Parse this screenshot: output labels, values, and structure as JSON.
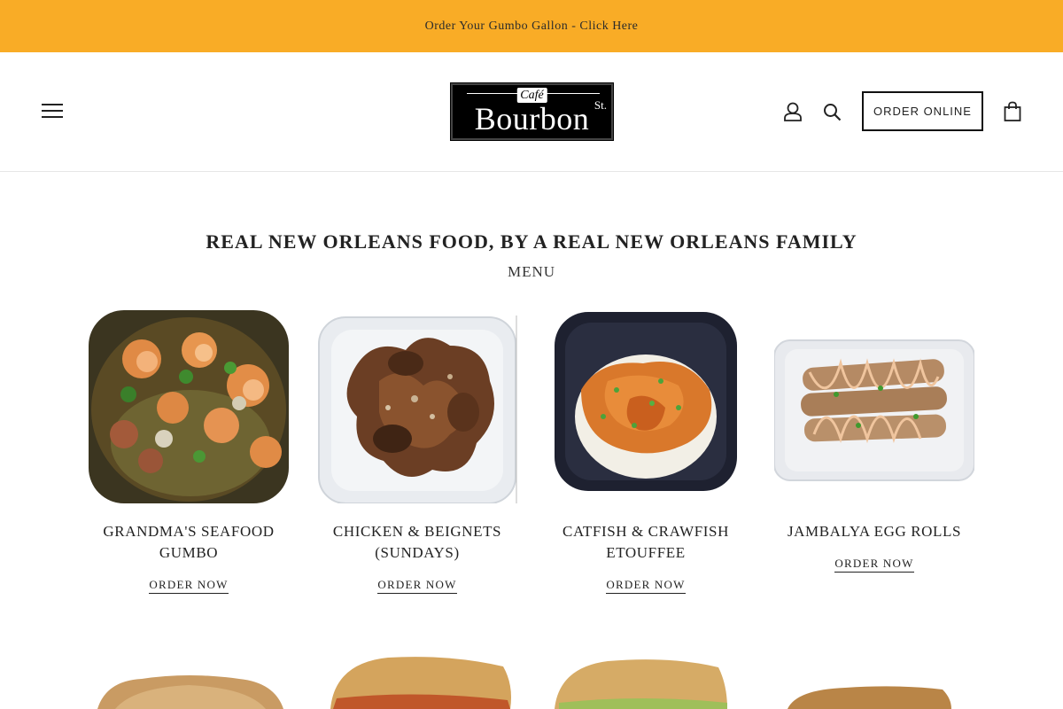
{
  "announcement": {
    "text": "Order Your Gumbo Gallon - Click Here"
  },
  "header": {
    "logo": {
      "cafe": "Café",
      "name": "Bourbon",
      "st": "St."
    },
    "order_button": "ORDER ONLINE",
    "icons": [
      "menu-icon",
      "user-icon",
      "search-icon",
      "cart-icon"
    ]
  },
  "main": {
    "heading": "REAL NEW ORLEANS FOOD, BY A REAL NEW ORLEANS FAMILY",
    "subheading": "MENU",
    "items": [
      {
        "name": "GRANDMA'S SEAFOOD GUMBO",
        "cta": "ORDER NOW"
      },
      {
        "name": "CHICKEN & BEIGNETS (SUNDAYS)",
        "cta": "ORDER NOW"
      },
      {
        "name": "CATFISH & CRAWFISH ETOUFFEE",
        "cta": "ORDER NOW"
      },
      {
        "name": "JAMBALYA EGG ROLLS",
        "cta": "ORDER NOW"
      }
    ]
  },
  "colors": {
    "announcement_bg": "#f9ac26",
    "text": "#222222",
    "border": "#e6e6e6"
  }
}
